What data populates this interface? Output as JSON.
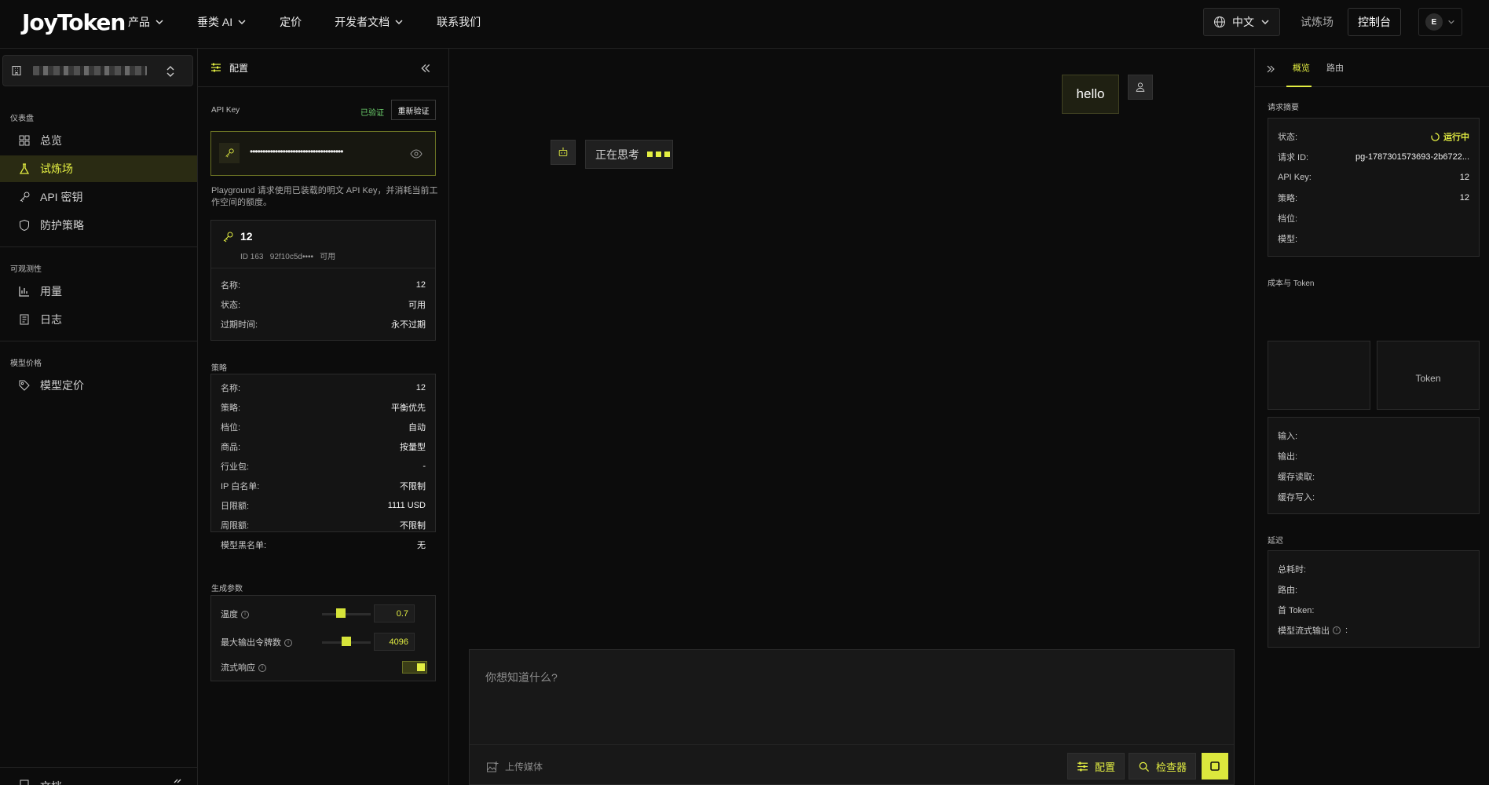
{
  "brand": {
    "logo": "JoyToken"
  },
  "nav": {
    "items": [
      "产品",
      "垂类 AI",
      "定价",
      "开发者文档",
      "联系我们"
    ]
  },
  "top_right": {
    "language": "中文",
    "playground": "试炼场",
    "console": "控制台",
    "avatar_letter": "E"
  },
  "sidebar": {
    "sections": [
      "仪表盘",
      "可观测性",
      "模型价格"
    ],
    "items": [
      "总览",
      "试炼场",
      "API 密钥",
      "防护策略",
      "用量",
      "日志",
      "模型定价"
    ],
    "footer_item": "文档"
  },
  "config": {
    "title": "配置",
    "api_key_label": "API Key",
    "verified": "已验证",
    "reverify": "重新验证",
    "masked_key": "•••••••••••••••••••••••••••••••••••••",
    "note": "Playground 请求使用已装载的明文 API Key，并消耗当前工作空间的额度。",
    "key_card": {
      "name": "12",
      "id_line": "ID 163   92f10c5d••••   可用",
      "rows": [
        {
          "k": "名称:",
          "v": "12"
        },
        {
          "k": "状态:",
          "v": "可用"
        },
        {
          "k": "过期时间:",
          "v": "永不过期"
        }
      ]
    },
    "strategy_label": "策略",
    "strategy_rows": [
      {
        "k": "名称:",
        "v": "12"
      },
      {
        "k": "策略:",
        "v": "平衡优先"
      },
      {
        "k": "档位:",
        "v": "自动"
      },
      {
        "k": "商品:",
        "v": "按量型"
      },
      {
        "k": "行业包:",
        "v": "-"
      },
      {
        "k": "IP 白名单:",
        "v": "不限制"
      },
      {
        "k": "日限额:",
        "v": "1111 USD"
      },
      {
        "k": "周限额:",
        "v": "不限制"
      },
      {
        "k": "模型黑名单:",
        "v": "无"
      }
    ],
    "gen_label": "生成参数",
    "temperature": {
      "label": "温度",
      "value": "0.7",
      "level": 0.35
    },
    "max_tokens": {
      "label": "最大输出令牌数",
      "value": "4096",
      "level": 0.5
    },
    "stream": {
      "label": "流式响应",
      "on": true
    }
  },
  "chat": {
    "user_msg": "hello",
    "thinking": "正在思考",
    "placeholder": "你想知道什么?",
    "upload": "上传媒体",
    "config_btn": "配置",
    "inspector_btn": "检查器"
  },
  "inspector": {
    "tabs": [
      "概览",
      "路由"
    ],
    "summary_label": "请求摘要",
    "summary": [
      {
        "k": "状态:",
        "v": "运行中"
      },
      {
        "k": "请求 ID:",
        "v": "pg-1787301573693-2b6722..."
      },
      {
        "k": "API Key:",
        "v": "12"
      },
      {
        "k": "策略:",
        "v": "12"
      },
      {
        "k": "档位:",
        "v": ""
      },
      {
        "k": "模型:",
        "v": ""
      }
    ],
    "cost_label": "成本与 Token",
    "token_card": "Token",
    "cost_rows": [
      "输入:",
      "输出:",
      "缓存读取:",
      "缓存写入:"
    ],
    "latency_label": "延迟",
    "latency_rows": [
      "总耗时:",
      "路由:",
      "首 Token:",
      "模型流式输出"
    ]
  },
  "colors": {
    "accent": "#e3ee42",
    "bg": "#0c0c0c",
    "panel": "#141414"
  }
}
